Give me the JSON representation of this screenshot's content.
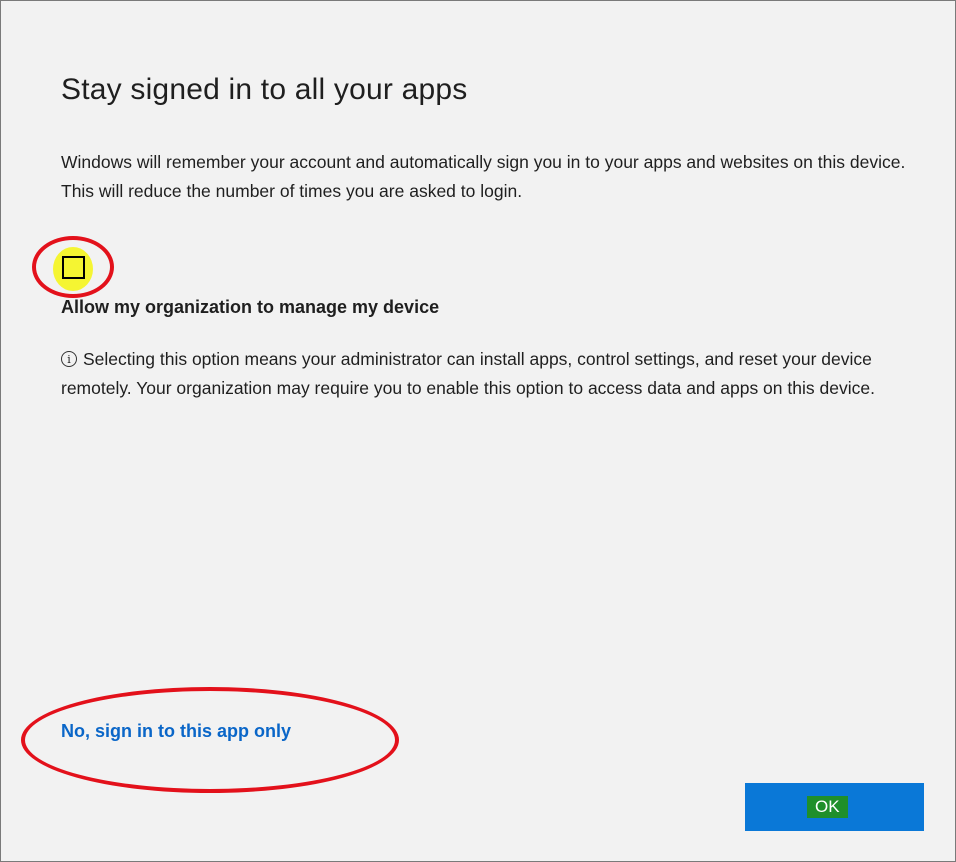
{
  "dialog": {
    "title": "Stay signed in to all your apps",
    "description": "Windows will remember your account and automatically sign you in to your apps and websites on this device. This will reduce the number of times you are asked to login.",
    "checkbox": {
      "label": "Allow my organization to manage my device",
      "checked": false
    },
    "info_icon": "info-icon",
    "info_text": "Selecting this option means your administrator can install apps, control settings, and reset your device remotely. Your organization may require you to enable this option to access data and apps on this device.",
    "link_label": "No, sign in to this app only",
    "ok_label": "OK"
  },
  "colors": {
    "background": "#f2f2f2",
    "link": "#0a66c8",
    "ok_button": "#0a78d7",
    "annotation_ring": "#e3111b",
    "highlight_yellow": "#f5f532",
    "ok_label_highlight": "#1f8f2a"
  }
}
